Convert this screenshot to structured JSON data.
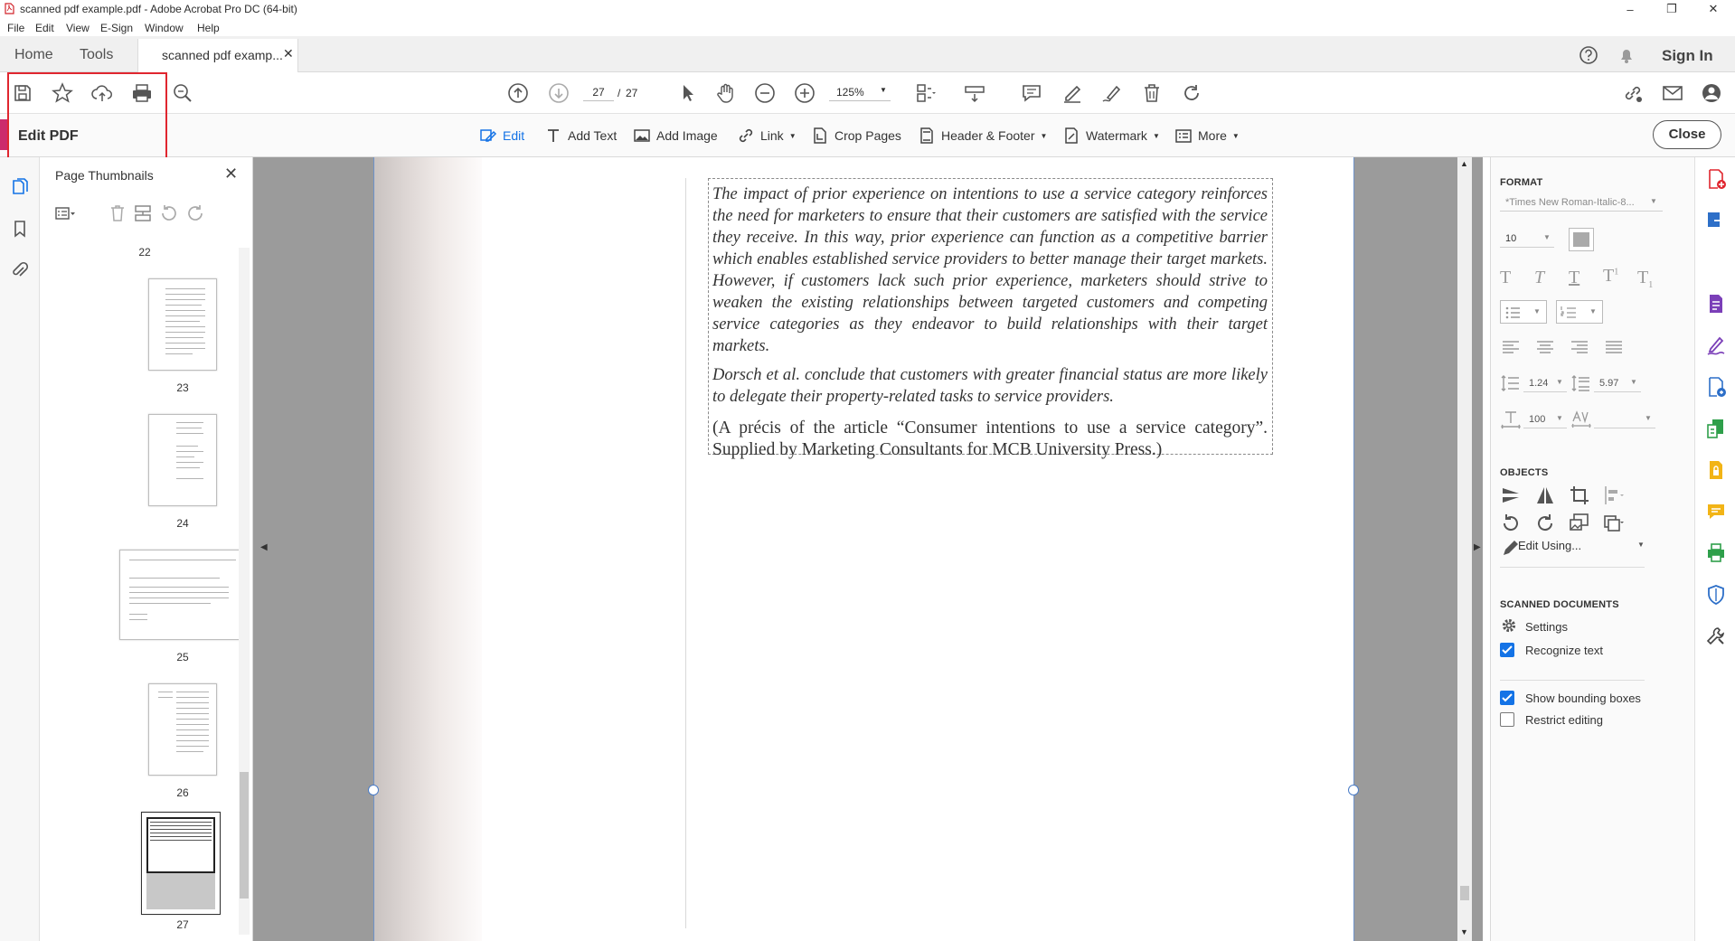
{
  "window": {
    "title": "scanned pdf example.pdf - Adobe Acrobat Pro DC (64-bit)",
    "controls": [
      "–",
      "❐",
      "✕"
    ]
  },
  "menubar": [
    "File",
    "Edit",
    "View",
    "E-Sign",
    "Window",
    "Help"
  ],
  "tabs": {
    "home": "Home",
    "tools": "Tools",
    "document": "scanned pdf examp...",
    "close_glyph": "✕",
    "sign_in": "Sign In"
  },
  "toolbar": {
    "page_current": "27",
    "page_separator": "/",
    "page_total": "27",
    "zoom": "125%"
  },
  "edit_toolbar": {
    "mode_title": "Edit PDF",
    "items": [
      "Edit",
      "Add Text",
      "Add Image",
      "Link",
      "Crop Pages",
      "Header & Footer",
      "Watermark",
      "More"
    ],
    "close": "Close"
  },
  "thumbnails": {
    "title": "Page Thumbnails",
    "pages": [
      "22",
      "23",
      "24",
      "25",
      "26",
      "27"
    ],
    "current_page": "27"
  },
  "document": {
    "paragraph1": "The impact of prior experience on intentions to use a service category reinforces the need for marketers to ensure that their customers are satisfied with the service they receive. In this way, prior experience can function as a competitive barrier which enables established service providers to better manage their target markets. However, if customers lack such prior experience, marketers should strive to weaken the existing relationships between targeted customers and competing service categories as they endeavor to build relationships with their target markets.",
    "paragraph2": "Dorsch et al. conclude that customers with greater financial status are more likely to delegate their property-related tasks to service providers.",
    "paragraph3": "(A précis of the article “Consumer intentions to use a service category”. Supplied by Marketing Consultants for MCB University Press.)"
  },
  "format_panel": {
    "format_header": "FORMAT",
    "font_name": "*Times New Roman-Italic-8...",
    "font_size": "10",
    "line_spacing": "1.24",
    "paragraph_spacing": "5.97",
    "horizontal_scale": "100",
    "char_spacing": "",
    "objects_header": "OBJECTS",
    "edit_using": "Edit Using...",
    "scanned_header": "SCANNED DOCUMENTS",
    "settings": "Settings",
    "recognize_text": {
      "label": "Recognize text",
      "checked": true
    },
    "show_bounding_boxes": {
      "label": "Show bounding boxes",
      "checked": true
    },
    "restrict_editing": {
      "label": "Restrict editing",
      "checked": false
    }
  },
  "colors": {
    "accent": "#cc2b6c",
    "highlight_box": "#e0262f",
    "checkbox": "#1473e6"
  }
}
